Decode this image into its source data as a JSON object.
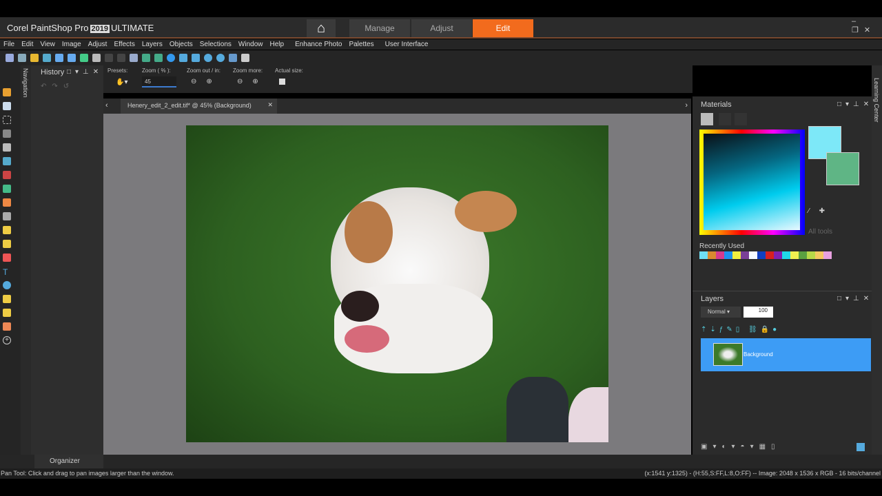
{
  "app": {
    "brand": "Corel PaintShop Pro",
    "year": "2019",
    "edition": "ULTIMATE"
  },
  "workspace_tabs": [
    {
      "label": "Manage"
    },
    {
      "label": "Adjust"
    },
    {
      "label": "Edit",
      "active": true
    }
  ],
  "menu": [
    "File",
    "Edit",
    "View",
    "Image",
    "Adjust",
    "Effects",
    "Layers",
    "Objects",
    "Selections",
    "Window",
    "Help",
    "Enhance Photo",
    "Palettes",
    "User Interface"
  ],
  "tool_options": {
    "presets": "Presets:",
    "zoom_label": "Zoom ( % ):",
    "zoom_value": "45",
    "zoom_out_in": "Zoom out / in:",
    "zoom_more": "Zoom more:",
    "actual_size": "Actual size:"
  },
  "navigation_tab": "Navigation",
  "history": {
    "title": "History"
  },
  "document": {
    "tab_label": "Henery_edit_2_edit.tif* @ 45% (Background)"
  },
  "materials": {
    "title": "Materials",
    "all_tools": "All tools",
    "recently_used": "Recently Used",
    "foreground": "#7de8f8",
    "background": "#5fb585",
    "recent_colors": [
      "#6fe0f5",
      "#d98a30",
      "#d63a8e",
      "#1e90f0",
      "#f0f040",
      "#7a3f96",
      "#f5fbff",
      "#1040c0",
      "#d82020",
      "#8020b0",
      "#20d8e8",
      "#f0f050",
      "#5aa040",
      "#b8d848",
      "#f5c860",
      "#e8a0e0"
    ]
  },
  "layers": {
    "title": "Layers",
    "blend_mode": "Normal",
    "opacity": "100",
    "items": [
      {
        "name": "Background",
        "selected": true
      }
    ]
  },
  "learning_center": "Learning Center",
  "organizer": "Organizer",
  "status": {
    "left": "Pan Tool: Click and drag to pan images larger than the window.",
    "right": "(x:1541 y:1325) - (H:55,S:FF,L:8,O:FF) -- Image:  2048 x 1536 x RGB - 16 bits/channel"
  },
  "colors": {
    "accent": "#f26b1d",
    "selection": "#3d9cf5"
  }
}
